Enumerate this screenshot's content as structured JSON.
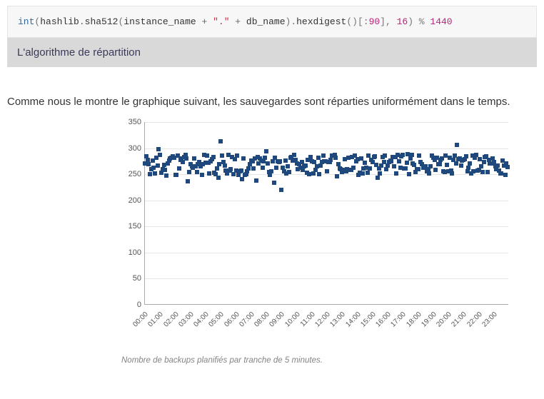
{
  "code": {
    "t1": "int",
    "t2": "(",
    "t3": "hashlib",
    "t4": ".",
    "t5": "sha512",
    "t6": "(",
    "t7": "instance_name",
    "t8": " + ",
    "t9": "\".\"",
    "t10": " + ",
    "t11": "db_name",
    "t12": ").",
    "t13": "hexdigest",
    "t14": "()[:",
    "t15": "90",
    "t16": "], ",
    "t17": "16",
    "t18": ") % ",
    "t19": "1440"
  },
  "caption_bar": "L'algorithme de répartition",
  "paragraph": "Comme nous le montre le graphique suivant, les sauvegardes sont réparties uniformément dans le temps.",
  "chart_caption": "Nombre de backups planifiés par tranche de 5 minutes.",
  "chart_data": {
    "type": "scatter",
    "title": "",
    "xlabel": "",
    "ylabel": "",
    "ylim": [
      0,
      350
    ],
    "y_ticks": [
      0,
      50,
      100,
      150,
      200,
      250,
      300,
      350
    ],
    "x_ticks": [
      "00:00",
      "01:00",
      "02:00",
      "03:00",
      "04:00",
      "05:00",
      "06:00",
      "07:00",
      "08:00",
      "09:00",
      "10:00",
      "11:00",
      "12:00",
      "13:00",
      "14:00",
      "15:00",
      "16:00",
      "17:00",
      "18:00",
      "19:00",
      "20:00",
      "21:00",
      "22:00",
      "23:00"
    ],
    "x_range_minutes": [
      0,
      1440
    ],
    "x_bin_minutes": 5,
    "approx_value_range": [
      230,
      310
    ],
    "series": [
      {
        "name": "backups",
        "note": "values ~ uniform noise around 260-280 per 5-min bin; rendered procedurally for 288 bins"
      }
    ]
  }
}
